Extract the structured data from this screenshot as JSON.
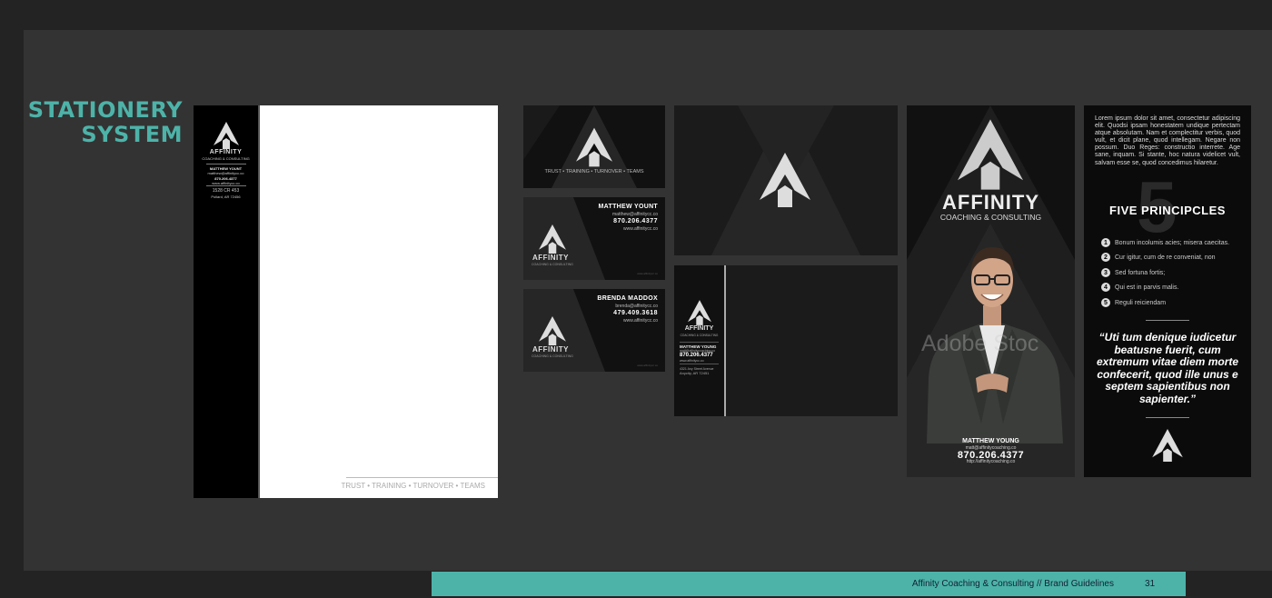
{
  "page": {
    "title_line1": "STATIONERY",
    "title_line2": "SYSTEM",
    "footer_text": "Affinity Coaching & Consulting // Brand Guidelines",
    "page_number": "31",
    "accent_color": "#4db3a9"
  },
  "letterhead": {
    "brand": "AFFINITY",
    "sub": "COACHING & CONSULTING",
    "name": "MATTHEW YOUNT",
    "email": "matthew@affinitycc.co",
    "phone": "870.206.4377",
    "url": "www.affinitycc.co",
    "address1": "1528 CR 453",
    "address2": "Pollard, AR 72456",
    "footer": "TRUST • TRAINING • TURNOVER • TEAMS",
    "logo_icon": "arrow-up-logo-icon"
  },
  "cards": {
    "front": {
      "tagline": "TRUST • TRAINING • TURNOVER • TEAMS"
    },
    "matthew": {
      "name": "MATTHEW YOUNT",
      "email": "matthew@affinitycc.co",
      "phone": "870.206.4377",
      "url": "www.affinitycc.co",
      "brand": "AFFINITY",
      "sub": "COACHING & CONSULTING",
      "small": "www.affinitycc.co"
    },
    "brenda": {
      "name": "BRENDA MADDOX",
      "email": "brenda@affinitycc.co",
      "phone": "479.409.3618",
      "url": "www.affinitycc.co",
      "brand": "AFFINITY",
      "sub": "COACHING & CONSULTING",
      "small": "www.affinitycc.co"
    }
  },
  "envelope": {
    "brand": "AFFINITY",
    "sub": "COACHING & CONSULTING",
    "name": "MATTHEW YOUNG",
    "email": "matt@affinitycoaching.co",
    "phone": "870.206.4377",
    "url": "www.affinitycc.co",
    "address1": "4321 Any Street Avenue",
    "address2": "Anycity, AR 72451"
  },
  "poster": {
    "brand": "AFFINITY",
    "sub": "COACHING & CONSULTING",
    "name": "MATTHEW YOUNG",
    "email": "matt@affinitycoaching.co",
    "phone": "870.206.4377",
    "url": "http://affinitycoaching.co",
    "watermark": "Adobe Stoc"
  },
  "principles": {
    "lorem": "Lorem ipsum dolor sit amet, consectetur adipiscing elit. Quodsi ipsam honestatem undique pertectam atque absolutam. Nam et complectitur verbis, quod vult, et dicit plane, quod intellegam. Negare non possum. Duo Reges: constructio interrete. Age sane, inquam. Si stante, hoc natura videlicet vult, salvam esse se, quod concedimus hilaretur.",
    "big_number": "5",
    "heading": "FIVE PRINCIPCLES",
    "items": [
      {
        "num": "1",
        "text": "Bonum incolumis acies; misera caecitas."
      },
      {
        "num": "2",
        "text": "Cur igitur, cum de re conveniat, non"
      },
      {
        "num": "3",
        "text": "Sed fortuna fortis;"
      },
      {
        "num": "4",
        "text": "Qui est in parvis malis."
      },
      {
        "num": "5",
        "text": "Reguli reiciendam"
      }
    ],
    "quote": "“Uti tum denique iudicetur beatusne fuerit, cum extremum vitae diem morte confecerit, quod ille unus e septem sapientibus non sapienter.”"
  }
}
